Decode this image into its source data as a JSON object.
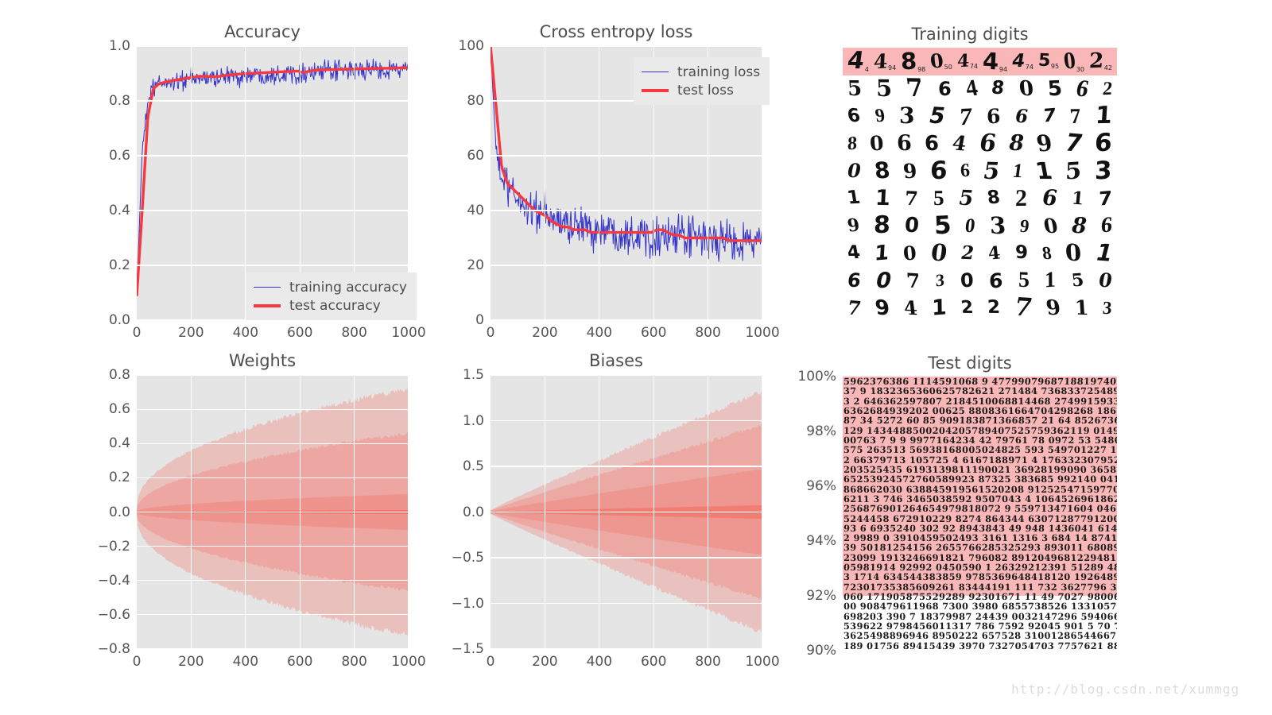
{
  "figure": {
    "background": "#ffffff",
    "axes_background": "#e5e5e5",
    "grid_color": "#ffffff",
    "tick_color": "#555555",
    "title_color": "#4d4d4d",
    "train_color": "#3333cc",
    "test_color": "#f8383f",
    "band_color": "#f4695f",
    "highlight_color": "#f9b7b7"
  },
  "watermark": {
    "text": "http://blog.csdn.net/xummgg"
  },
  "chart_data": [
    {
      "type": "line",
      "id": "accuracy",
      "title": "Accuracy",
      "xlabel": "",
      "ylabel": "",
      "xlim": [
        0,
        1000
      ],
      "ylim": [
        0.0,
        1.0
      ],
      "xticks": [
        0,
        200,
        400,
        600,
        800,
        1000
      ],
      "yticks": [
        "0.0",
        "0.2",
        "0.4",
        "0.6",
        "0.8",
        "1.0"
      ],
      "grid": true,
      "legend_position": "lower right",
      "series": [
        {
          "name": "training accuracy",
          "color": "#3333cc",
          "linewidth": 1,
          "style": "noisy",
          "noise": 0.055,
          "values": [
            0.1,
            0.62,
            0.8,
            0.845,
            0.862,
            0.866,
            0.869,
            0.872,
            0.874,
            0.877,
            0.879,
            0.881,
            0.883,
            0.885,
            0.886,
            0.888,
            0.889,
            0.89,
            0.891,
            0.893,
            0.894,
            0.895,
            0.896,
            0.897,
            0.898,
            0.899,
            0.9,
            0.901,
            0.902,
            0.903,
            0.904,
            0.905,
            0.906,
            0.906,
            0.907,
            0.908,
            0.909,
            0.91,
            0.911,
            0.912,
            0.912,
            0.913,
            0.914,
            0.914,
            0.915,
            0.915,
            0.916,
            0.916,
            0.917,
            0.918
          ]
        },
        {
          "name": "test accuracy",
          "color": "#f8383f",
          "linewidth": 3.4,
          "style": "smooth",
          "values": [
            0.088,
            0.405,
            0.742,
            0.845,
            0.862,
            0.868,
            0.872,
            0.876,
            0.879,
            0.883,
            0.886,
            0.889,
            0.89,
            0.889,
            0.888,
            0.89,
            0.893,
            0.895,
            0.897,
            0.899,
            0.9,
            0.901,
            0.902,
            0.903,
            0.904,
            0.905,
            0.906,
            0.907,
            0.908,
            0.909,
            0.903,
            0.908,
            0.912,
            0.913,
            0.914,
            0.914,
            0.915,
            0.915,
            0.916,
            0.916,
            0.917,
            0.917,
            0.918,
            0.918,
            0.919,
            0.919,
            0.92,
            0.92,
            0.921,
            0.921
          ]
        }
      ]
    },
    {
      "type": "line",
      "id": "loss",
      "title": "Cross entropy loss",
      "xlabel": "",
      "ylabel": "",
      "xlim": [
        0,
        1000
      ],
      "ylim": [
        0,
        100
      ],
      "xticks": [
        0,
        200,
        400,
        600,
        800,
        1000
      ],
      "yticks": [
        "0",
        "20",
        "40",
        "60",
        "80",
        "100"
      ],
      "grid": true,
      "legend_position": "upper right",
      "series": [
        {
          "name": "training loss",
          "color": "#3333cc",
          "linewidth": 1,
          "style": "noisy",
          "noise": 11,
          "values": [
            100,
            62,
            52,
            48,
            46,
            44,
            42,
            41,
            40,
            39,
            38,
            37,
            36,
            36,
            35,
            35,
            34,
            34,
            34,
            33,
            33,
            33,
            33,
            32,
            32,
            32,
            32,
            32,
            31,
            31,
            31,
            31,
            31,
            30,
            30,
            30,
            30,
            30,
            30,
            29,
            29,
            29,
            29,
            29,
            29,
            29,
            29,
            29,
            29,
            29
          ]
        },
        {
          "name": "test loss",
          "color": "#f8383f",
          "linewidth": 3.4,
          "style": "smooth",
          "values": [
            100,
            78,
            56,
            50,
            48,
            46,
            44,
            42,
            40,
            39,
            38,
            36,
            35,
            34,
            34,
            33,
            33,
            33,
            32,
            32,
            32,
            32,
            32,
            32,
            32,
            32,
            32,
            32,
            32,
            32,
            33,
            33,
            32,
            31,
            31,
            30,
            30,
            30,
            30,
            30,
            30,
            30,
            30,
            29,
            29,
            29,
            29,
            29,
            29,
            29
          ]
        }
      ]
    },
    {
      "type": "area",
      "id": "weights",
      "title": "Weights",
      "xlabel": "",
      "ylabel": "",
      "xlim": [
        0,
        1000
      ],
      "ylim": [
        -0.8,
        0.8
      ],
      "xticks": [
        0,
        200,
        400,
        600,
        800,
        1000
      ],
      "yticks": [
        "-0.8",
        "-0.6",
        "-0.4",
        "-0.2",
        "0.0",
        "0.2",
        "0.4",
        "0.6",
        "0.8"
      ],
      "grid": true,
      "bands": [
        {
          "name": "min-max",
          "opacity": 0.3,
          "end_extent": 0.72,
          "start_extent": 0.02,
          "shape": 0.45
        },
        {
          "name": "p1-p99",
          "opacity": 0.3,
          "end_extent": 0.46,
          "start_extent": 0.012,
          "shape": 0.5
        },
        {
          "name": "p25-p75",
          "opacity": 0.3,
          "end_extent": 0.105,
          "start_extent": 0.006,
          "shape": 0.55
        },
        {
          "name": "median",
          "opacity": 0.75,
          "end_extent": 0.012,
          "start_extent": 0.002,
          "shape": 0.6
        }
      ]
    },
    {
      "type": "area",
      "id": "biases",
      "title": "Biases",
      "xlabel": "",
      "ylabel": "",
      "xlim": [
        0,
        1000
      ],
      "ylim": [
        -1.5,
        1.5
      ],
      "xticks": [
        0,
        200,
        400,
        600,
        800,
        1000
      ],
      "yticks": [
        "-1.5",
        "-1.0",
        "-0.5",
        "0.0",
        "0.5",
        "1.0",
        "1.5"
      ],
      "grid": true,
      "bands": [
        {
          "name": "min-max",
          "opacity": 0.28,
          "end_extent": 1.32,
          "start_extent": 0.02,
          "shape": 0.95
        },
        {
          "name": "p1-p99",
          "opacity": 0.28,
          "end_extent": 0.95,
          "start_extent": 0.015,
          "shape": 0.95
        },
        {
          "name": "p25-p75",
          "opacity": 0.28,
          "end_extent": 0.47,
          "start_extent": 0.01,
          "shape": 0.95
        },
        {
          "name": "median",
          "opacity": 0.55,
          "end_extent": 0.075,
          "start_extent": 0.004,
          "shape": 0.95
        }
      ]
    },
    {
      "type": "image",
      "id": "training_digits",
      "title": "Training digits",
      "rows": 10,
      "cols": 10,
      "highlight_rows": 1,
      "digits": [
        [
          "4",
          "4",
          "8",
          "0",
          "4",
          "4",
          "4",
          "5",
          "0",
          "2"
        ],
        [
          "5",
          "5",
          "7",
          "6",
          "4",
          "8",
          "0",
          "5",
          "6",
          "2"
        ],
        [
          "6",
          "9",
          "3",
          "5",
          "7",
          "6",
          "6",
          "7",
          "7",
          "1"
        ],
        [
          "8",
          "0",
          "6",
          "6",
          "4",
          "6",
          "8",
          "9",
          "7",
          "6"
        ],
        [
          "0",
          "8",
          "9",
          "6",
          "6",
          "5",
          "1",
          "1",
          "5",
          "3"
        ],
        [
          "1",
          "1",
          "7",
          "5",
          "5",
          "8",
          "2",
          "6",
          "1",
          "7"
        ],
        [
          "9",
          "8",
          "0",
          "5",
          "0",
          "3",
          "9",
          "0",
          "8",
          "6"
        ],
        [
          "4",
          "1",
          "0",
          "0",
          "2",
          "4",
          "9",
          "8",
          "0",
          "1"
        ],
        [
          "6",
          "0",
          "7",
          "3",
          "0",
          "6",
          "5",
          "1",
          "5",
          "0"
        ],
        [
          "7",
          "9",
          "4",
          "1",
          "2",
          "2",
          "7",
          "9",
          "1",
          "3"
        ]
      ],
      "subscripts": [
        "4",
        "94",
        "98",
        "50",
        "74",
        "94",
        "74",
        "95",
        "30",
        "42"
      ]
    },
    {
      "type": "image",
      "id": "test_digits",
      "title": "Test digits",
      "yticks": [
        "90%",
        "92%",
        "94%",
        "96%",
        "98%",
        "100%"
      ],
      "ylim": [
        90,
        100
      ],
      "highlight_from": 92,
      "highlight_to": 100,
      "rows": 28,
      "cols": 90
    }
  ]
}
